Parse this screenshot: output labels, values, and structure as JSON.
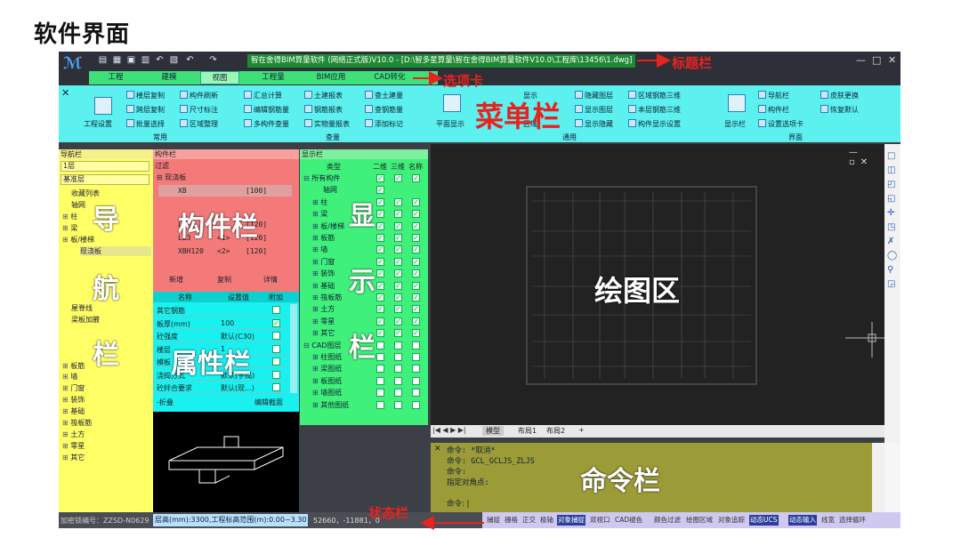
{
  "heading": "软件界面",
  "window": {
    "title": "智在舍得BIM算量软件 (网络正式版)V10.0 - [D:\\智多星算量\\智在舍得BIM算量软件V10.0\\工程库\\13456\\1.dwg]",
    "controls": [
      "—",
      "□",
      "✕"
    ]
  },
  "tabs": [
    "工程",
    "建模",
    "视图",
    "工程量",
    "BIM应用",
    "CAD转化"
  ],
  "ribbon": {
    "left": {
      "big": "工程设置",
      "items": [
        "楼层复制",
        "跨层复制",
        "批量选择",
        "构件刷新",
        "尺寸标注",
        "区域整理"
      ],
      "group": "常用"
    },
    "query": {
      "items": [
        "汇总计算",
        "编辑钢筋量",
        "多构件查量",
        "土建报表",
        "钢筋报表",
        "实物量报表",
        "查土建量",
        "查钢筋量",
        "添加标记"
      ],
      "group": "查量"
    },
    "general": {
      "big": "平面显示",
      "items": [
        "隐藏图层",
        "显示图层",
        "显示隐藏",
        "区域钢筋三维",
        "本层钢筋三维",
        "构件显示设置"
      ],
      "frag": [
        "显示",
        "区域"
      ],
      "group": "通用"
    },
    "ui": {
      "big": "显示栏",
      "items": [
        "导航栏",
        "构件栏",
        "设置选项卡",
        "皮肤更换",
        "恢复默认"
      ],
      "group": "界面"
    }
  },
  "nav": {
    "title": "导航栏",
    "floor": "1层",
    "layer": "基准层",
    "items": [
      "收藏列表",
      "轴网",
      "柱",
      "梁",
      "板/楼梯",
      "现浇板",
      "",
      "",
      "",
      "",
      "屋脊线",
      "梁板加腋",
      "",
      "",
      "",
      "板筋",
      "墙",
      "门窗",
      "装饰",
      "基础",
      "筏板筋",
      "土方",
      "零星",
      "其它"
    ],
    "selected": 5
  },
  "comp": {
    "title": "构件栏",
    "filter": "过滤",
    "group": "现浇板",
    "rows": [
      [
        "XB",
        "",
        "[100]"
      ],
      [
        "LB2",
        "",
        "[120]"
      ],
      [
        "LB3",
        "<1>",
        "[120]"
      ],
      [
        "XBH120",
        "<2>",
        "[120]"
      ]
    ],
    "buttons": [
      "新增",
      "复制",
      "详情"
    ]
  },
  "attr": {
    "headers": [
      "名称",
      "设置值",
      "附加"
    ],
    "rows": [
      [
        "其它钢筋",
        ""
      ],
      [
        "板厚(mm)",
        "100"
      ],
      [
        "砼强度",
        "默认(C30)"
      ],
      [
        "楼层",
        "1"
      ],
      [
        "模板",
        ""
      ],
      [
        "浇捣方式",
        "默认(手捣)"
      ],
      [
        "砼拌合要求",
        "默认(现...)"
      ]
    ],
    "buttons": [
      "折叠",
      "编辑截面"
    ]
  },
  "disp": {
    "title": "显示栏",
    "headers": [
      "类型",
      "二维",
      "三维",
      "名称"
    ],
    "rows": [
      "所有构件",
      "轴网",
      "柱",
      "梁",
      "板/楼梯",
      "板筋",
      "墙",
      "门窗",
      "装饰",
      "基础",
      "筏板筋",
      "土方",
      "零星",
      "其它",
      "CAD图层",
      "柱图纸",
      "梁图纸",
      "板图纸",
      "墙图纸",
      "其他图纸"
    ]
  },
  "draw": {
    "layout_tabs": [
      "模型",
      "布局1",
      "布局2",
      "+"
    ],
    "win": [
      "—",
      "▫",
      "✕"
    ],
    "right_tools": [
      "□",
      "◫",
      "◰",
      "◱",
      "✛",
      "◳",
      "✗",
      "◯",
      "⚲",
      "◲"
    ]
  },
  "cmd": {
    "lines": [
      "命令: *取消*",
      "命令: GCL_GCLJS_ZLJS",
      "命令:",
      "指定对角点:"
    ],
    "prompt": "命令:"
  },
  "status": {
    "lock": "加密锁编号：ZZSD-N0629",
    "height": "层高(mm):3300,工程标高范围(m):0.00~3.30",
    "coords": "52660，-11881，0",
    "toggles": [
      "捕捉",
      "栅格",
      "正交",
      "极轴",
      "对象捕捉",
      "双视口",
      "CAD褪色",
      "颜色过滤",
      "绘图区域",
      "对象追踪",
      "动态UCS",
      "动态输入",
      "线宽",
      "选择循环"
    ],
    "active": [
      4,
      10,
      11
    ]
  },
  "annotations": {
    "title_bar": "标题栏",
    "tab_card": "选项卡",
    "menu_bar": "菜单栏",
    "nav": [
      "导",
      "航",
      "栏"
    ],
    "comp": "构件栏",
    "attr": "属性栏",
    "disp": [
      "显",
      "示",
      "栏"
    ],
    "draw": "绘图区",
    "cmd": "命令栏",
    "status": "状态栏"
  },
  "colors": {
    "ribbon": "#5cf0ef",
    "nav": "#ffff66",
    "comp": "#f47a7a",
    "attr": "#19f0f0",
    "disp": "#3ff07a",
    "cmd": "#9b9b38",
    "arrow": "#e8231f"
  }
}
